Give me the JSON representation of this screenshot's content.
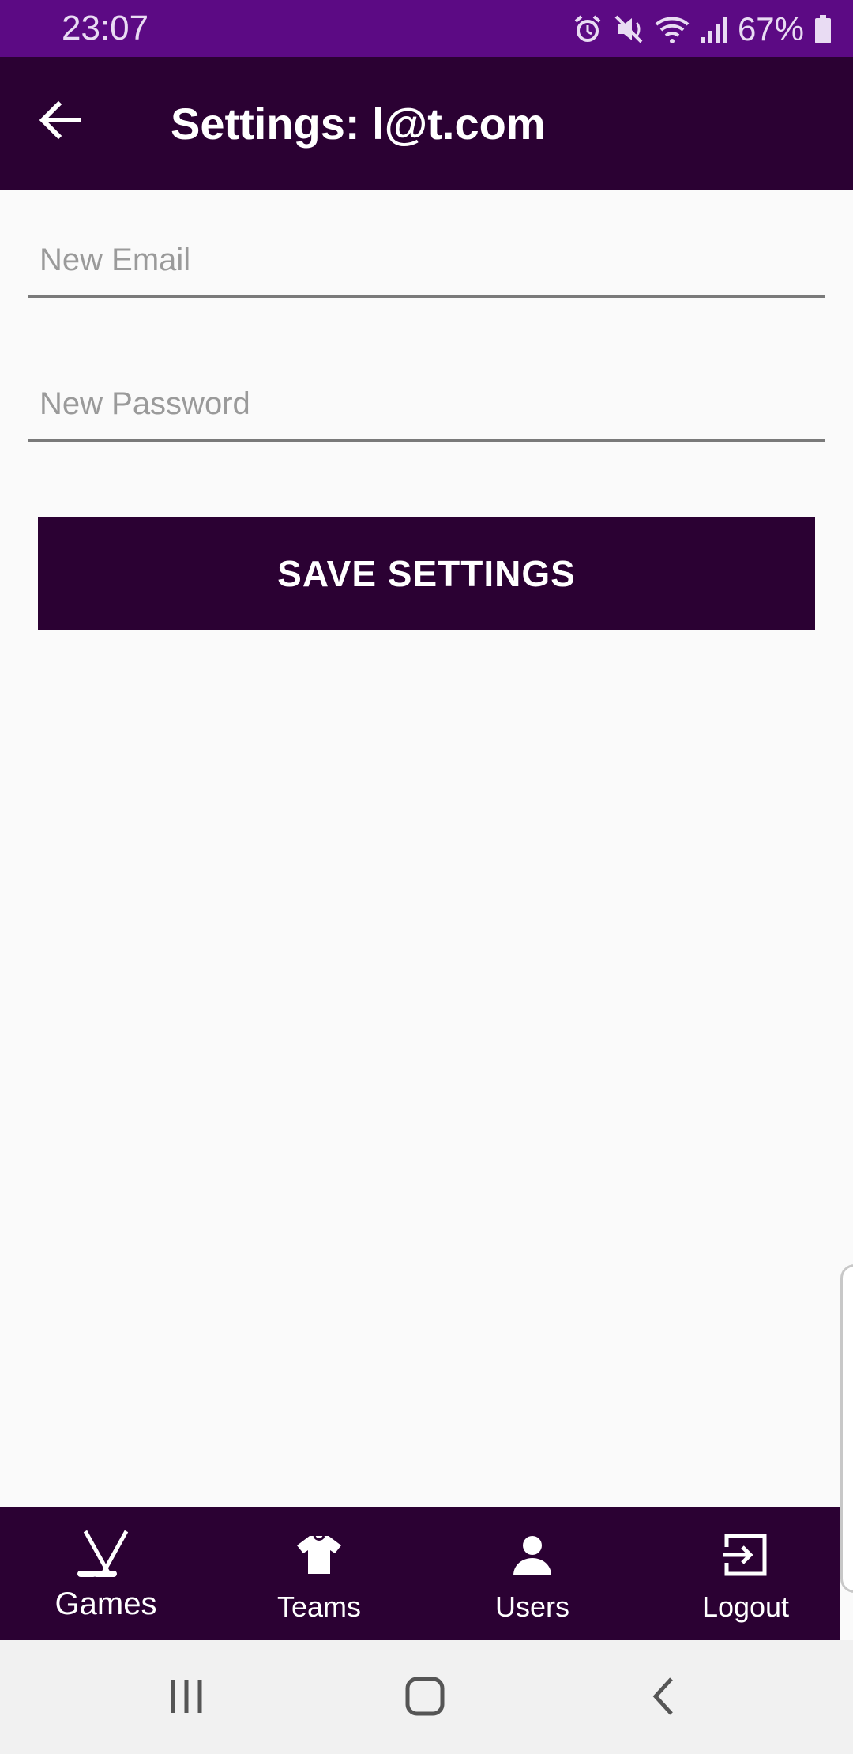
{
  "status_bar": {
    "time": "23:07",
    "battery": "67%",
    "icons": [
      "alarm-icon",
      "mute-icon",
      "wifi-icon",
      "signal-icon",
      "battery-icon"
    ]
  },
  "app_bar": {
    "title": "Settings: l@t.com",
    "back_icon": "arrow-left-icon"
  },
  "form": {
    "email": {
      "placeholder": "New Email",
      "value": ""
    },
    "password": {
      "placeholder": "New Password",
      "value": ""
    },
    "save_label": "SAVE SETTINGS"
  },
  "bottom_nav": {
    "items": [
      {
        "label": "Games",
        "icon": "hockey-sticks-icon",
        "active": true
      },
      {
        "label": "Teams",
        "icon": "shirt-icon",
        "active": false
      },
      {
        "label": "Users",
        "icon": "person-icon",
        "active": false
      },
      {
        "label": "Logout",
        "icon": "logout-icon",
        "active": false
      }
    ]
  },
  "system_nav": {
    "icons": [
      "recent-apps-icon",
      "home-icon",
      "back-icon"
    ]
  },
  "colors": {
    "status_bar": "#5c0a84",
    "primary": "#2b0133",
    "background": "#fafafa",
    "system_nav": "#f1f1f1"
  }
}
